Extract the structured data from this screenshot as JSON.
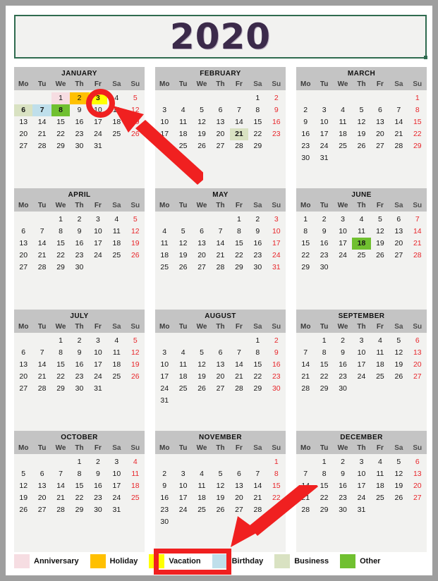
{
  "title": "2020",
  "weekdays": [
    "Mo",
    "Tu",
    "We",
    "Th",
    "Fr",
    "Sa",
    "Su"
  ],
  "legend": {
    "items": [
      {
        "label": "Anniversary",
        "key": "anniversary",
        "color": "#f6dde2"
      },
      {
        "label": "Holiday",
        "key": "holiday",
        "color": "#ffc000"
      },
      {
        "label": "Vacation",
        "key": "vacation",
        "color": "#ffff00"
      },
      {
        "label": "Birthday",
        "key": "birthday",
        "color": "#bfdfeb"
      },
      {
        "label": "Business",
        "key": "business",
        "color": "#d9e2c2"
      },
      {
        "label": "Other",
        "key": "other",
        "color": "#70c030"
      }
    ]
  },
  "annotations": {
    "circle_target": "January 3",
    "rect_target": "Vacation legend swatch",
    "arrow_1_points_to": "January 3",
    "arrow_2_points_to": "Vacation legend swatch",
    "color": "#f02020"
  },
  "months": [
    {
      "name": "JANUARY",
      "lead_blanks": 2,
      "num_days": 31,
      "events": {
        "1": "anniversary",
        "2": "holiday",
        "3": "vacation",
        "6": "business",
        "7": "birthday",
        "8": "other"
      }
    },
    {
      "name": "FEBRUARY",
      "lead_blanks": 5,
      "num_days": 29,
      "events": {
        "21": "business"
      }
    },
    {
      "name": "MARCH",
      "lead_blanks": 6,
      "num_days": 31,
      "events": {}
    },
    {
      "name": "APRIL",
      "lead_blanks": 2,
      "num_days": 30,
      "events": {}
    },
    {
      "name": "MAY",
      "lead_blanks": 4,
      "num_days": 31,
      "events": {}
    },
    {
      "name": "JUNE",
      "lead_blanks": 0,
      "num_days": 30,
      "events": {
        "18": "other"
      }
    },
    {
      "name": "JULY",
      "lead_blanks": 2,
      "num_days": 31,
      "events": {}
    },
    {
      "name": "AUGUST",
      "lead_blanks": 5,
      "num_days": 31,
      "events": {}
    },
    {
      "name": "SEPTEMBER",
      "lead_blanks": 1,
      "num_days": 30,
      "events": {}
    },
    {
      "name": "OCTOBER",
      "lead_blanks": 3,
      "num_days": 31,
      "events": {}
    },
    {
      "name": "NOVEMBER",
      "lead_blanks": 6,
      "num_days": 30,
      "events": {}
    },
    {
      "name": "DECEMBER",
      "lead_blanks": 1,
      "num_days": 31,
      "events": {}
    }
  ]
}
